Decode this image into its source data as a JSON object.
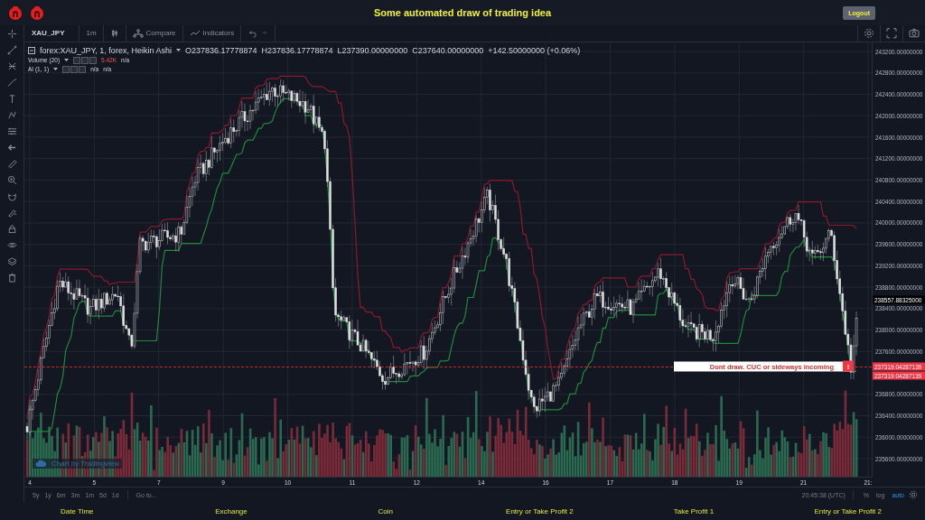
{
  "header": {
    "title": "Some automated draw of trading idea",
    "logout_button": "Logout"
  },
  "toolbar": {
    "symbol": "XAU_JPY",
    "interval": "1m",
    "compare": "Compare",
    "indicators": "Indicators"
  },
  "legend": {
    "title": "forex:XAU_JPY, 1, forex, Heikin Ashi",
    "ohlc": [
      "O237836.17778874",
      "H237836.17778874",
      "L237390.00000000",
      "C237640.00000000",
      "+142.50000000 (+0.06%)"
    ],
    "studies": [
      {
        "name": "Volume (20)",
        "value": "5.42K",
        "readings": [
          "n/a"
        ]
      },
      {
        "name": "AI (1, 1)",
        "readings": [
          "n/a",
          "n/a"
        ]
      }
    ]
  },
  "chart": {
    "attribution": "Chart by Tradingview",
    "alert": {
      "text": "Dont draw. CUC or sideways incoming",
      "icon_text": "!"
    },
    "price_axis": {
      "labels": [
        "243200.00000000",
        "242800.00000000",
        "242400.00000000",
        "242000.00000000",
        "241600.00000000",
        "241200.00000000",
        "240800.00000000",
        "240400.00000000",
        "240000.00000000",
        "239600.00000000",
        "239200.00000000",
        "238800.00000000",
        "238400.00000000",
        "238000.00000000",
        "237600.00000000",
        "236800.00000000",
        "236400.00000000",
        "236000.00000000",
        "235600.00000000"
      ],
      "last_price": "238557.88325000",
      "alert_prices": [
        "237319.04287139",
        "237319.04287139"
      ]
    },
    "time_axis": [
      "4",
      "5",
      "7",
      "9",
      "10",
      "11",
      "12",
      "14",
      "16",
      "17",
      "18",
      "19",
      "21",
      "21:"
    ]
  },
  "bottom_bar": {
    "ranges": [
      "5y",
      "1y",
      "6m",
      "3m",
      "1m",
      "5d",
      "1d"
    ],
    "goto": "Go to...",
    "clock": "20:45:38 (UTC)",
    "scale_buttons": [
      {
        "label": "%",
        "selected": false
      },
      {
        "label": "log",
        "selected": false
      },
      {
        "label": "auto",
        "selected": true
      }
    ]
  },
  "footer": [
    "Date Time",
    "Exchange",
    "Coin",
    "Entry or Take Profit 2",
    "Take Profit 1",
    "Entry or Take Profit 2"
  ]
}
